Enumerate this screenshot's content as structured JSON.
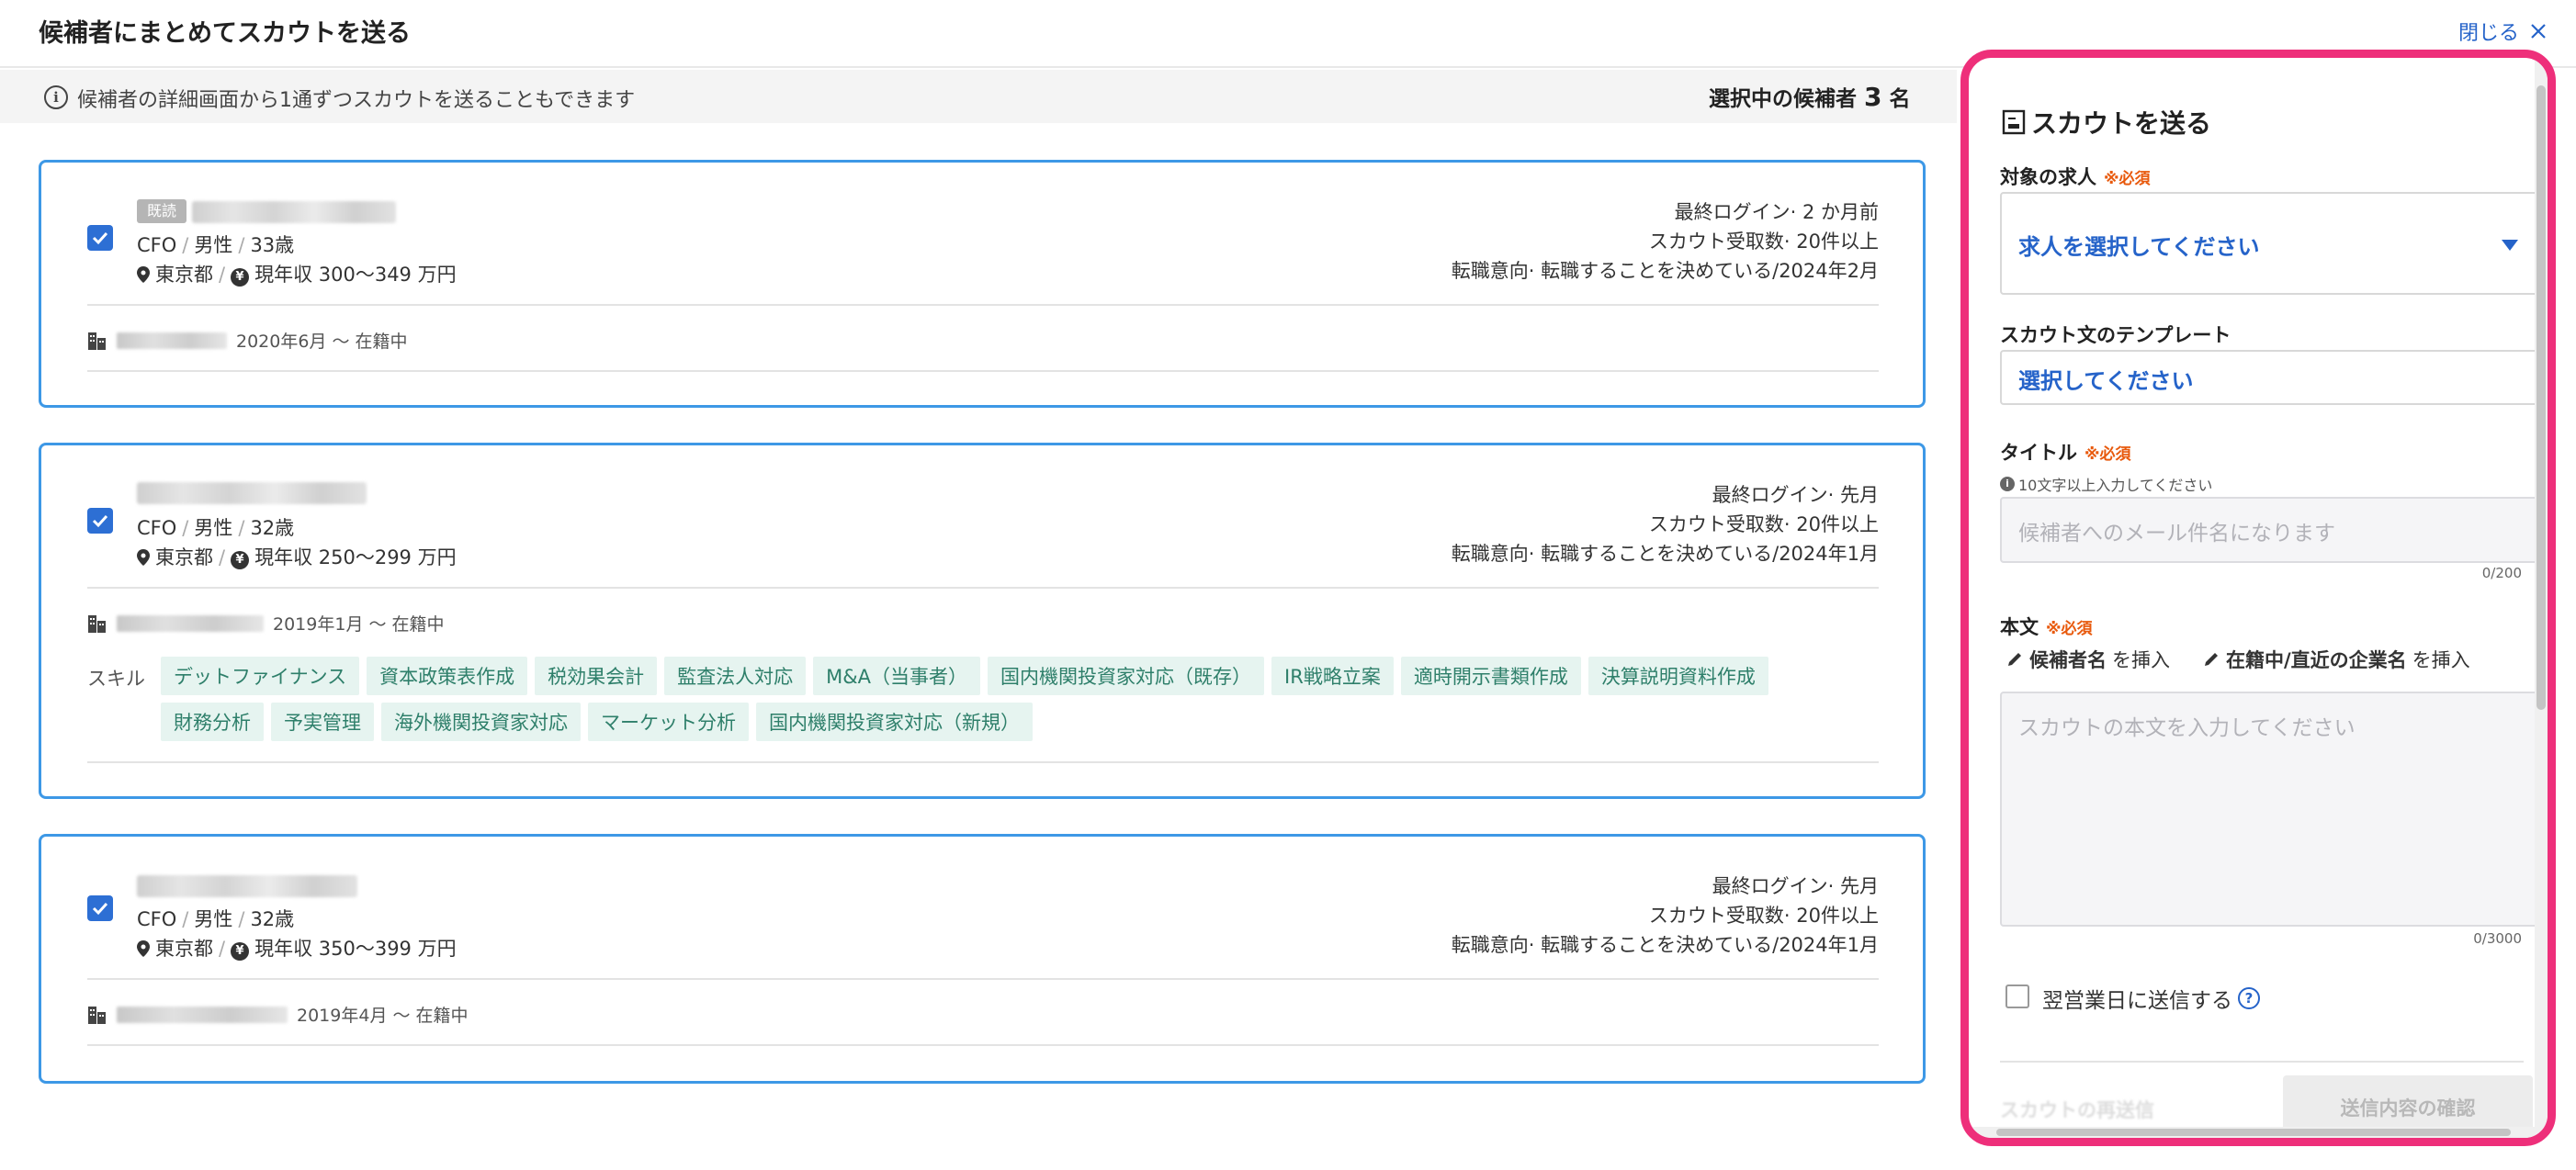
{
  "header": {
    "title": "候補者にまとめてスカウトを送る",
    "close_label": "閉じる"
  },
  "info_bar": {
    "text": "候補者の詳細画面から1通ずつスカウトを送ることもできます",
    "selected_prefix": "選択中の候補者",
    "selected_count": "3",
    "selected_suffix": "名"
  },
  "candidates": [
    {
      "badge": "既読",
      "name": "",
      "role": "CFO",
      "gender": "男性",
      "age": "33歳",
      "location": "東京都",
      "salary": "現年収 300〜349 万円",
      "last_login": "最終ログイン· 2 か月前",
      "scout_count": "スカウト受取数· 20件以上",
      "intent": "転職意向· 転職することを決めている/2024年2月",
      "company_period": "2020年6月 〜 在籍中",
      "checked": true
    },
    {
      "badge": "",
      "name": "",
      "role": "CFO",
      "gender": "男性",
      "age": "32歳",
      "location": "東京都",
      "salary": "現年収 250〜299 万円",
      "last_login": "最終ログイン· 先月",
      "scout_count": "スカウト受取数· 20件以上",
      "intent": "転職意向· 転職することを決めている/2024年1月",
      "company_period": "2019年1月 〜 在籍中",
      "skills_label": "スキル",
      "skills": [
        "デットファイナンス",
        "資本政策表作成",
        "税効果会計",
        "監査法人対応",
        "M&A（当事者）",
        "国内機関投資家対応（既存）",
        "IR戦略立案",
        "適時開示書類作成",
        "決算説明資料作成",
        "財務分析",
        "予実管理",
        "海外機関投資家対応",
        "マーケット分析",
        "国内機関投資家対応（新規）"
      ],
      "checked": true
    },
    {
      "badge": "",
      "name": "",
      "role": "CFO",
      "gender": "男性",
      "age": "32歳",
      "location": "東京都",
      "salary": "現年収 350〜399 万円",
      "last_login": "最終ログイン· 先月",
      "scout_count": "スカウト受取数· 20件以上",
      "intent": "転職意向· 転職することを決めている/2024年1月",
      "company_period": "2019年4月 〜 在籍中",
      "checked": true
    }
  ],
  "panel": {
    "title": "スカウトを送る",
    "required_mark": "※必須",
    "job_label": "対象の求人",
    "job_placeholder": "求人を選択してください",
    "template_label": "スカウト文のテンプレート",
    "template_placeholder": "選択してください",
    "title_label": "タイトル",
    "title_hint": "10文字以上入力してください",
    "title_placeholder": "候補者へのメール件名になります",
    "title_counter": "0/200",
    "body_label": "本文",
    "insert_name_bold": "候補者名",
    "insert_name_rest": "を挿入",
    "insert_company_bold": "在籍中/直近の企業名",
    "insert_company_rest": "を挿入",
    "body_placeholder": "スカウトの本文を入力してください",
    "body_counter": "0/3000",
    "next_day_label": "翌営業日に送信する",
    "resend_label": "スカウトの再送信",
    "confirm_button": "送信内容の確認"
  },
  "colors": {
    "accent": "#2563c9",
    "card_border": "#3d98e6",
    "panel_highlight": "#ee2f7a",
    "required": "#e8590c",
    "skill_bg": "#e6f4f0",
    "skill_text": "#2e7f6a"
  },
  "icons": [
    "close-icon",
    "info-icon",
    "checkbox-checked-icon",
    "location-pin-icon",
    "yen-icon",
    "building-icon",
    "document-icon",
    "pencil-icon",
    "help-icon",
    "caret-down-icon"
  ]
}
